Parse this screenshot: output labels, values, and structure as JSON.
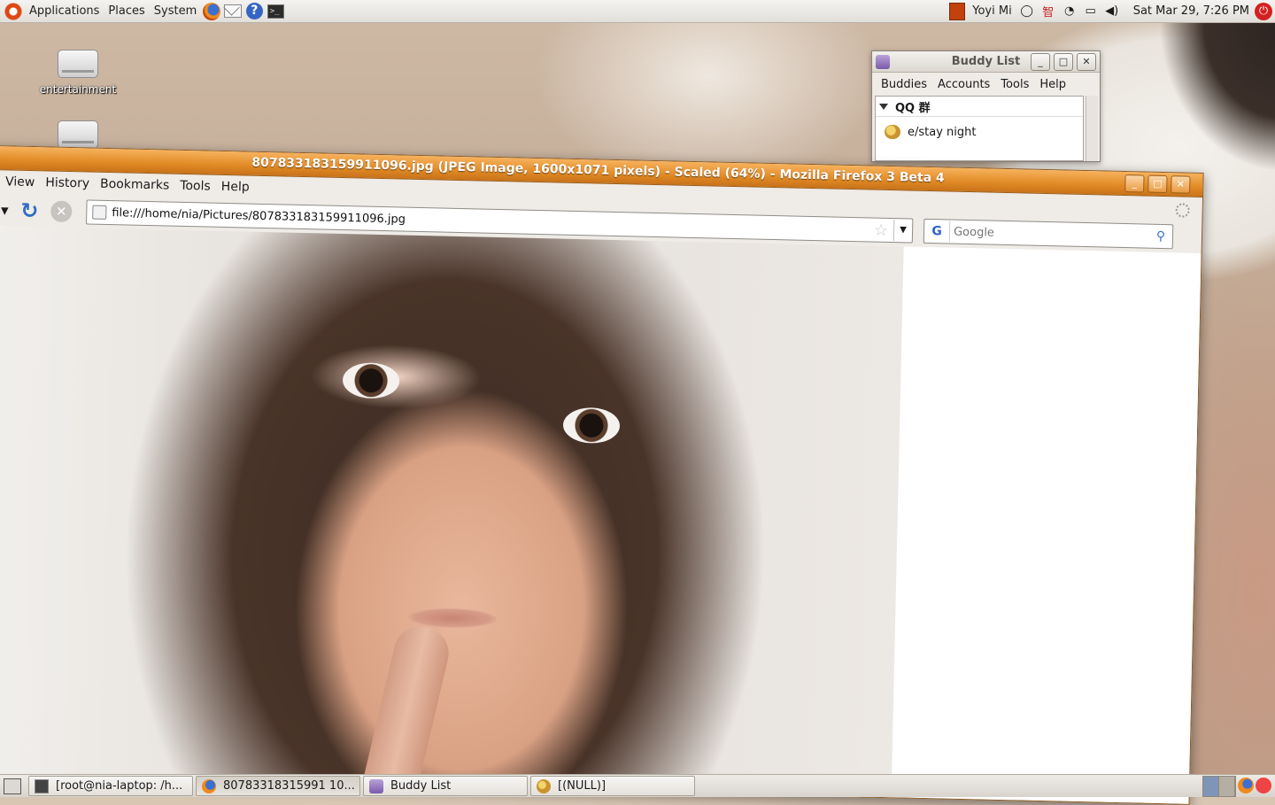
{
  "top_panel": {
    "menus": [
      "Applications",
      "Places",
      "System"
    ],
    "launchers": [
      "firefox-icon",
      "mail-icon",
      "help-icon",
      "terminal-icon"
    ],
    "tray": {
      "user": "Yoyi Mi",
      "ime_char": "智",
      "clock": "Sat Mar 29,  7:26 PM"
    }
  },
  "desktop": {
    "icons": [
      {
        "label": "entertainment"
      },
      {
        "label": ""
      }
    ]
  },
  "buddy_list": {
    "title": "Buddy List",
    "menus": [
      "Buddies",
      "Accounts",
      "Tools",
      "Help"
    ],
    "group": "QQ 群",
    "buddies": [
      "e/stay night"
    ]
  },
  "firefox": {
    "title": "807833183159911096.jpg (JPEG Image, 1600x1071 pixels) - Scaled (64%) - Mozilla Firefox 3 Beta 4",
    "menus": [
      "View",
      "History",
      "Bookmarks",
      "Tools",
      "Help"
    ],
    "url": "file:///home/nia/Pictures/807833183159911096.jpg",
    "search_placeholder": "Google",
    "search_engine": "G",
    "image_scale_percent": 64
  },
  "bottom_panel": {
    "tasks": [
      {
        "label": "[root@nia-laptop: /h...",
        "icon": "terminal-icon"
      },
      {
        "label": "80783318315991 10...",
        "icon": "firefox-icon"
      },
      {
        "label": "Buddy List",
        "icon": "pidgin-icon"
      },
      {
        "label": "[(NULL)]",
        "icon": "qq-icon"
      }
    ]
  },
  "colors": {
    "titlebar_active": "#e08a25",
    "panel_bg": "#e2dfda",
    "accent_ubuntu": "#dd4814"
  }
}
